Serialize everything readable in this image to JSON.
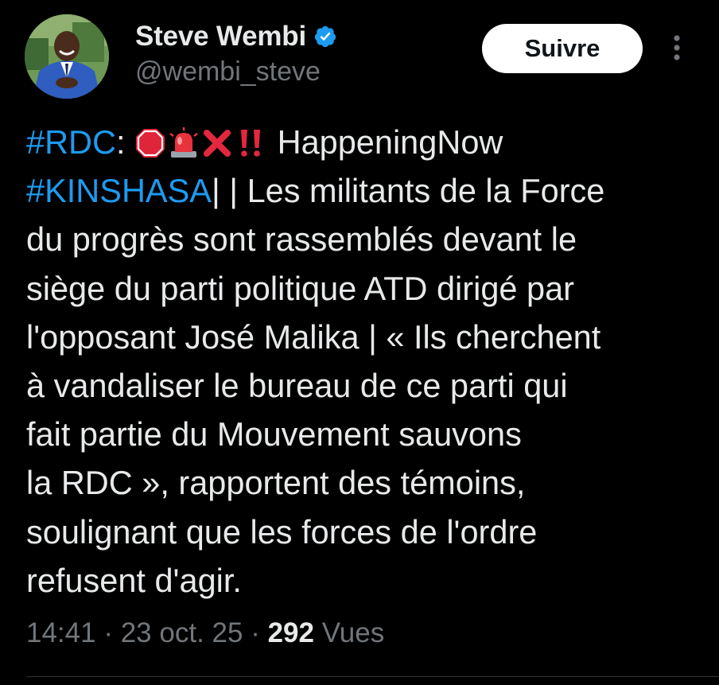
{
  "author": {
    "name": "Steve Wembi",
    "handle": "@wembi_steve",
    "verified": true,
    "verified_badge_color": "#1d9bf0"
  },
  "follow_button": {
    "label": "Suivre"
  },
  "more_menu": {
    "icon": "more-vertical-icon"
  },
  "tweet": {
    "line1": {
      "hashtag": "#RDC",
      "after_hashtag": ":",
      "emojis": [
        "stop-sign",
        "police-light",
        "cross-mark",
        "double-exclamation"
      ],
      "text": "HappeningNow"
    },
    "line2": {
      "hashtag": "#KINSHASA",
      "text": "| | Les militants de la Force"
    },
    "lines": [
      "du progrès sont rassemblés devant le",
      "siège du parti politique ATD dirigé par",
      "l'opposant José Malika | « Ils cherchent",
      "à vandaliser le bureau de ce parti qui",
      "fait partie du Mouvement sauvons",
      "la RDC », rapportent des témoins,",
      "soulignant que les forces de l'ordre",
      "refusent d'agir."
    ]
  },
  "meta": {
    "time": "14:41",
    "date": "23 oct. 25",
    "separator": "·",
    "views_count": "292",
    "views_label": "Vues"
  },
  "colors": {
    "background": "#000000",
    "text": "#e7e9ea",
    "secondary_text": "#71767b",
    "link": "#1d9bf0",
    "button_bg": "#ffffff",
    "divider": "#2f3336"
  }
}
